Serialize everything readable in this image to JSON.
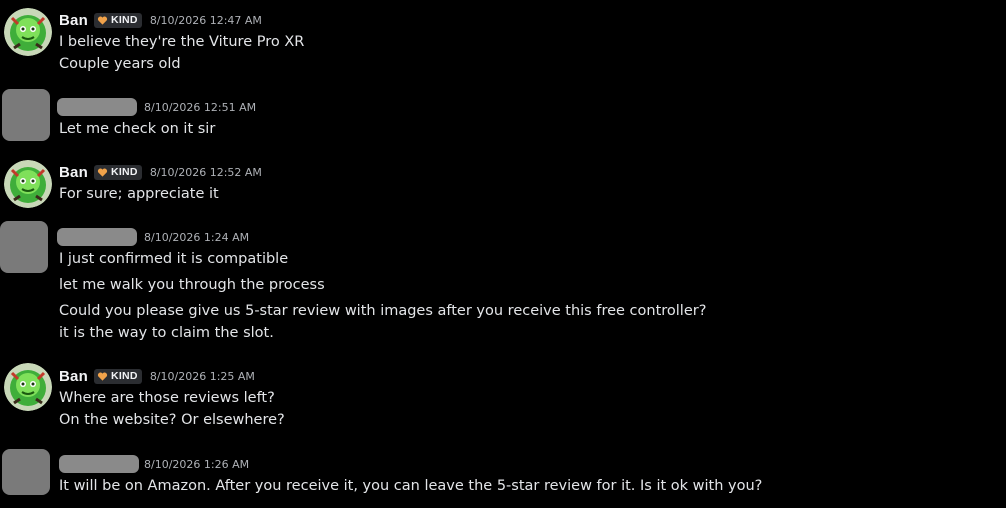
{
  "messages": [
    {
      "author": "Ban",
      "author_visible": true,
      "tag": "KIND",
      "timestamp": "8/10/2026 12:47 AM",
      "lines": [
        "I believe they're the Viture Pro XR",
        "Couple years old"
      ]
    },
    {
      "author": "",
      "author_visible": false,
      "timestamp": "8/10/2026 12:51 AM",
      "lines": [
        "Let me check on it sir"
      ]
    },
    {
      "author": "Ban",
      "author_visible": true,
      "tag": "KIND",
      "timestamp": "8/10/2026 12:52 AM",
      "lines": [
        "For sure; appreciate it"
      ]
    },
    {
      "author": "",
      "author_visible": false,
      "timestamp": "8/10/2026 1:24 AM",
      "lines": [
        "I just confirmed it is compatible",
        "let me walk you through the process",
        "Could you please give us 5-star review with images after you receive this free controller?",
        "it is the way to claim the slot."
      ]
    },
    {
      "author": "Ban",
      "author_visible": true,
      "tag": "KIND",
      "timestamp": "8/10/2026 1:25 AM",
      "lines": [
        "Where are those reviews left?",
        "On the website? Or elsewhere?"
      ]
    },
    {
      "author": "",
      "author_visible": false,
      "timestamp": "8/10/2026 1:26 AM",
      "lines": [
        "It will be on Amazon. After you receive it, you can leave the 5-star review for it. Is it ok with you?"
      ]
    }
  ],
  "colors": {
    "background": "#000000",
    "username": "#f2f3f5",
    "text": "#e3e5e8",
    "timestamp": "#aeb1b6",
    "tag_bg": "#2b2d31",
    "tag_heart": "#f0a24a",
    "blur": "#7a7a7a"
  },
  "icons": {
    "tag": "heart-icon",
    "avatar": "green-character-avatar"
  }
}
